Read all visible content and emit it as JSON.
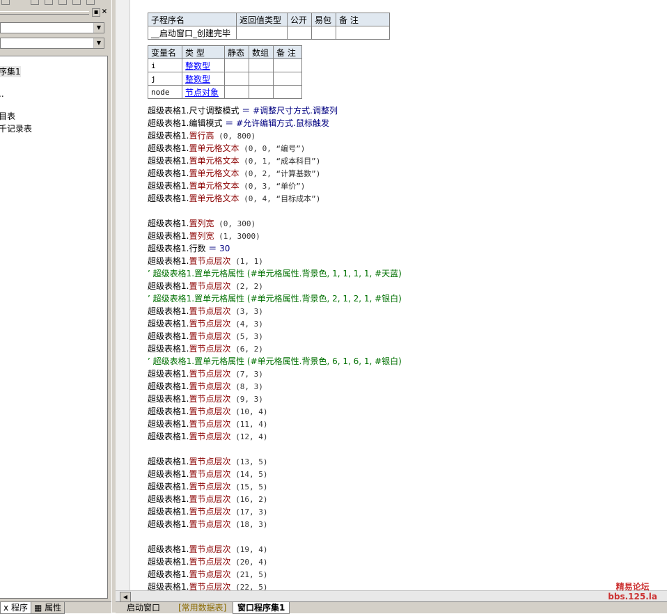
{
  "left_panel": {
    "tree_items": [
      "序集1",
      "..",
      "目表",
      "千记录表"
    ],
    "tabs": {
      "program": "程序",
      "program_prefix": "x",
      "props": "属性"
    },
    "pin_glyph": "▪",
    "close_glyph": "×"
  },
  "sub_table": {
    "headers": [
      "子程序名",
      "返回值类型",
      "公开",
      "易包",
      "备 注"
    ],
    "name": "__启动窗口_创建完毕"
  },
  "var_table": {
    "headers": [
      "变量名",
      "类 型",
      "静态",
      "数组",
      "备 注"
    ],
    "rows": [
      {
        "name": "i",
        "type": "整数型"
      },
      {
        "name": "j",
        "type": "整数型"
      },
      {
        "name": "node",
        "type": "节点对象"
      }
    ]
  },
  "code_lines": [
    {
      "t": "s",
      "text": "超级表格1.尺寸调整模式 ＝ #调整尺寸方式.调整列"
    },
    {
      "t": "s",
      "text": "超级表格1.编辑模式 ＝ #允许编辑方式.鼠标触发"
    },
    {
      "t": "s",
      "text": "超级表格1.置行高 (0, 800)"
    },
    {
      "t": "s",
      "text": "超级表格1.置单元格文本 (0, 0, “编号”)"
    },
    {
      "t": "s",
      "text": "超级表格1.置单元格文本 (0, 1, “成本科目”)"
    },
    {
      "t": "s",
      "text": "超级表格1.置单元格文本 (0, 2, “计算基数”)"
    },
    {
      "t": "s",
      "text": "超级表格1.置单元格文本 (0, 3, “单价”)"
    },
    {
      "t": "s",
      "text": "超级表格1.置单元格文本 (0, 4, “目标成本”)"
    },
    {
      "t": "b",
      "text": ""
    },
    {
      "t": "s",
      "text": "超级表格1.置列宽 (0, 300)"
    },
    {
      "t": "s",
      "text": "超级表格1.置列宽 (1, 3000)"
    },
    {
      "t": "s",
      "text": "超级表格1.行数 ＝ 30"
    },
    {
      "t": "s",
      "text": "超级表格1.置节点层次 (1, 1)"
    },
    {
      "t": "c",
      "text": "’ 超级表格1.置单元格属性 (#单元格属性.背景色, 1, 1, 1, 1, #天蓝)"
    },
    {
      "t": "s",
      "text": "超级表格1.置节点层次 (2, 2)"
    },
    {
      "t": "c",
      "text": "’ 超级表格1.置单元格属性 (#单元格属性.背景色, 2, 1, 2, 1, #银白)"
    },
    {
      "t": "s",
      "text": "超级表格1.置节点层次 (3, 3)"
    },
    {
      "t": "s",
      "text": "超级表格1.置节点层次 (4, 3)"
    },
    {
      "t": "s",
      "text": "超级表格1.置节点层次 (5, 3)"
    },
    {
      "t": "s",
      "text": "超级表格1.置节点层次 (6, 2)"
    },
    {
      "t": "c",
      "text": "’ 超级表格1.置单元格属性 (#单元格属性.背景色, 6, 1, 6, 1, #银白)"
    },
    {
      "t": "s",
      "text": "超级表格1.置节点层次 (7, 3)"
    },
    {
      "t": "s",
      "text": "超级表格1.置节点层次 (8, 3)"
    },
    {
      "t": "s",
      "text": "超级表格1.置节点层次 (9, 3)"
    },
    {
      "t": "s",
      "text": "超级表格1.置节点层次 (10, 4)"
    },
    {
      "t": "s",
      "text": "超级表格1.置节点层次 (11, 4)"
    },
    {
      "t": "s",
      "text": "超级表格1.置节点层次 (12, 4)"
    },
    {
      "t": "b",
      "text": ""
    },
    {
      "t": "s",
      "text": "超级表格1.置节点层次 (13, 5)"
    },
    {
      "t": "s",
      "text": "超级表格1.置节点层次 (14, 5)"
    },
    {
      "t": "s",
      "text": "超级表格1.置节点层次 (15, 5)"
    },
    {
      "t": "s",
      "text": "超级表格1.置节点层次 (16, 2)"
    },
    {
      "t": "s",
      "text": "超级表格1.置节点层次 (17, 3)"
    },
    {
      "t": "s",
      "text": "超级表格1.置节点层次 (18, 3)"
    },
    {
      "t": "b",
      "text": ""
    },
    {
      "t": "s",
      "text": "超级表格1.置节点层次 (19, 4)"
    },
    {
      "t": "s",
      "text": "超级表格1.置节点层次 (20, 4)"
    },
    {
      "t": "s",
      "text": "超级表格1.置节点层次 (21, 5)"
    },
    {
      "t": "s",
      "text": "超级表格1.置节点层次 (22, 5)"
    }
  ],
  "doc_tabs": [
    "启动窗口",
    "[常用数据表]",
    "窗口程序集1"
  ],
  "watermark": {
    "line1": "精易论坛",
    "line2": "bbs.125.la"
  },
  "colors": {
    "method": "#8b0000",
    "comment": "#007000",
    "type_link": "#0000ff",
    "watermark": "#cc3333"
  }
}
